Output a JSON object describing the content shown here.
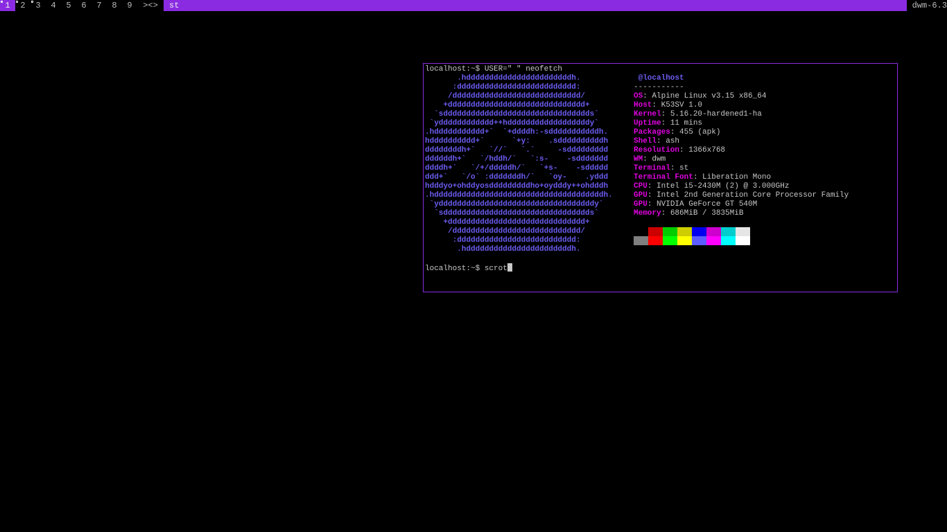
{
  "bar": {
    "tags": [
      "1",
      "2",
      "3",
      "4",
      "5",
      "6",
      "7",
      "8",
      "9"
    ],
    "layout_symbol": "><>",
    "window_title": "st",
    "status": "dwm-6.3",
    "colors": {
      "accent": "#8a2be2",
      "fg": "#bbbbbb",
      "sel_fg": "#eeeeee",
      "bg": "#000000"
    }
  },
  "terminal": {
    "prompt1": "localhost:~$ USER=\" \" neofetch",
    "ascii_logo": "       .hdddddddddddddddddddddddh.\n      :dddddddddddddddddddddddddd:\n     /dddddddddddddddddddddddddddd/\n    +dddddddddddddddddddddddddddddd+\n  `sdddddddddddddddddddddddddddddddds`\n `ydddddddddddd++hddddddddddddddddddy`\n.hddddddddddd+`  `+ddddh:-sdddddddddddh.\nhdddddddddd+`      `+y:    .sddddddddddh\nddddddddh+`   `//`   `.`     -sddddddddd\nddddddh+`   `/hddh/`   `:s-    -sddddddd\nddddh+`   `/+/dddddh/`   `+s-    -sddddd\nddd+`   `/o` :dddddddh/`   `oy-    .yddd\nhdddyo+ohddyosdddddddddho+oydddy++ohdddh\n.hdddddddddddddddddddddddddddddddddddddh.\n `yddddddddddddddddddddddddddddddddddy`\n  `sdddddddddddddddddddddddddddddddds`\n    +dddddddddddddddddddddddddddddd+\n     /dddddddddddddddddddddddddddd/\n      :dddddddddddddddddddddddddd:\n       .hdddddddddddddddddddddddh.",
    "user_host": " @localhost",
    "separator": "-----------",
    "info": [
      {
        "key": "OS",
        "value": "Alpine Linux v3.15 x86_64"
      },
      {
        "key": "Host",
        "value": "K53SV 1.0"
      },
      {
        "key": "Kernel",
        "value": "5.16.20-hardened1-ha"
      },
      {
        "key": "Uptime",
        "value": "11 mins"
      },
      {
        "key": "Packages",
        "value": "455 (apk)"
      },
      {
        "key": "Shell",
        "value": "ash"
      },
      {
        "key": "Resolution",
        "value": "1366x768"
      },
      {
        "key": "WM",
        "value": "dwm"
      },
      {
        "key": "Terminal",
        "value": "st"
      },
      {
        "key": "Terminal Font",
        "value": "Liberation Mono"
      },
      {
        "key": "CPU",
        "value": "Intel i5-2430M (2) @ 3.000GHz"
      },
      {
        "key": "GPU",
        "value": "Intel 2nd Generation Core Processor Family"
      },
      {
        "key": "GPU",
        "value": "NVIDIA GeForce GT 540M"
      },
      {
        "key": "Memory",
        "value": "686MiB / 3835MiB"
      }
    ],
    "palette_normal": [
      "#000000",
      "#cd0000",
      "#00cd00",
      "#cdcd00",
      "#0000ee",
      "#cd00cd",
      "#00cdcd",
      "#e5e5e5"
    ],
    "palette_bright": [
      "#7f7f7f",
      "#ff0000",
      "#00ff00",
      "#ffff00",
      "#5c5cff",
      "#ff00ff",
      "#00ffff",
      "#ffffff"
    ],
    "prompt2": "localhost:~$ scrot",
    "colors": {
      "border": "#8a2be2",
      "logo": "#6a5cf0",
      "key": "#e000e0",
      "text": "#c8c8c8"
    }
  }
}
